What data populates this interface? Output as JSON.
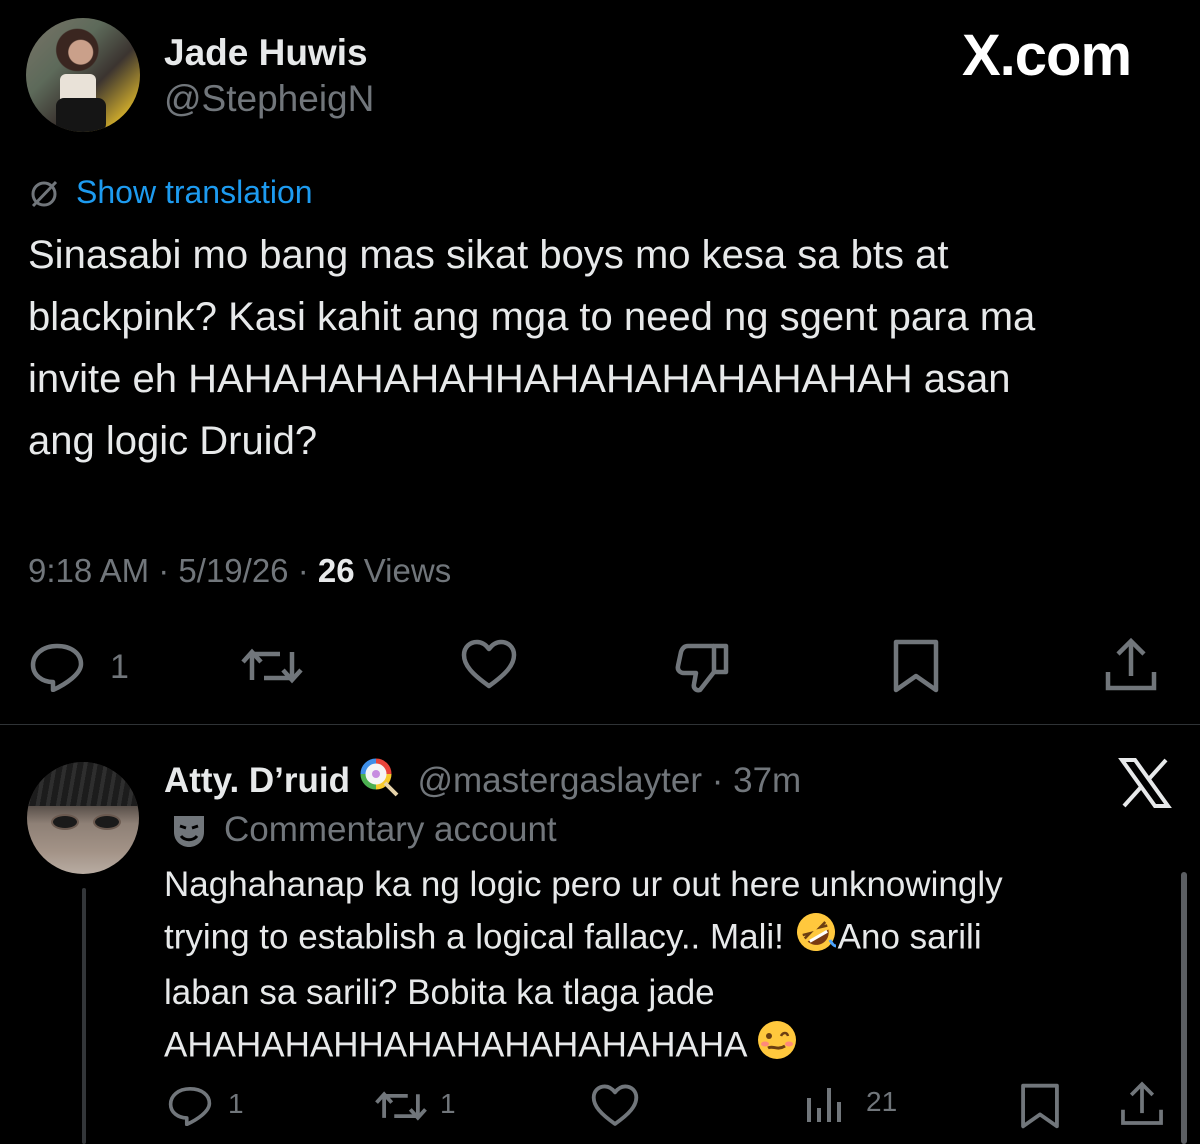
{
  "watermark": "X.com",
  "tweet": {
    "author_name": "Jade Huwis",
    "author_handle": "@StepheigN",
    "translate_label": "Show translation",
    "text_lines": [
      "Sinasabi mo bang mas sikat boys mo kesa sa bts at",
      "blackpink? Kasi kahit ang mga to need ng sgent para ma",
      "invite eh HAHAHAHAHAHHAHAHAHAHAHAHAH asan",
      "ang logic Druid?"
    ],
    "time": "9:18 AM",
    "date": "5/19/26",
    "views_count": "26",
    "views_label": "Views",
    "reply_count": "1",
    "icons": [
      "reply-icon",
      "retweet-icon",
      "like-icon",
      "dislike-icon",
      "bookmark-icon",
      "share-icon"
    ]
  },
  "reply": {
    "author_name": "Atty. D’ruid",
    "author_handle": "@mastergaslayter",
    "age": "37m",
    "label_text": "Commentary account",
    "text_lines": [
      "Naghahanap ka ng logic pero ur out here unknowingly",
      "trying to establish a logical fallacy.. Mali!",
      "Ano sarili",
      "laban sa sarili? Bobita ka tlaga jade",
      "AHAHAHAHHAHAHAHAHAHAHAHA"
    ],
    "reply_count": "1",
    "retweet_count": "1",
    "views_count": "21"
  },
  "colors": {
    "background": "#000000",
    "text": "#e7e9ea",
    "muted": "#71767b",
    "link": "#1d9bf0"
  }
}
